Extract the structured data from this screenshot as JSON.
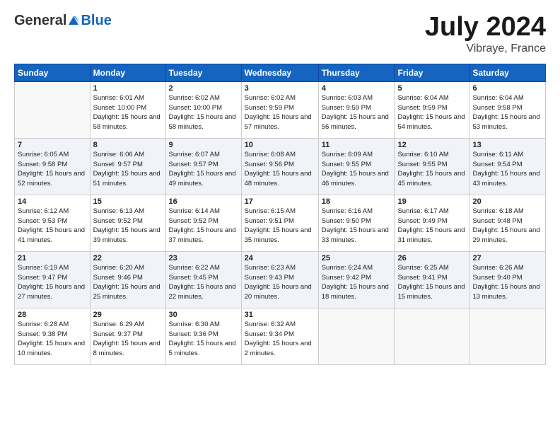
{
  "header": {
    "logo_general": "General",
    "logo_blue": "Blue",
    "month_title": "July 2024",
    "location": "Vibraye, France"
  },
  "weekdays": [
    "Sunday",
    "Monday",
    "Tuesday",
    "Wednesday",
    "Thursday",
    "Friday",
    "Saturday"
  ],
  "weeks": [
    [
      {
        "day": "",
        "empty": true
      },
      {
        "day": "1",
        "sunrise": "6:01 AM",
        "sunset": "10:00 PM",
        "daylight": "15 hours and 58 minutes."
      },
      {
        "day": "2",
        "sunrise": "6:02 AM",
        "sunset": "10:00 PM",
        "daylight": "15 hours and 58 minutes."
      },
      {
        "day": "3",
        "sunrise": "6:02 AM",
        "sunset": "9:59 PM",
        "daylight": "15 hours and 57 minutes."
      },
      {
        "day": "4",
        "sunrise": "6:03 AM",
        "sunset": "9:59 PM",
        "daylight": "15 hours and 56 minutes."
      },
      {
        "day": "5",
        "sunrise": "6:04 AM",
        "sunset": "9:59 PM",
        "daylight": "15 hours and 54 minutes."
      },
      {
        "day": "6",
        "sunrise": "6:04 AM",
        "sunset": "9:58 PM",
        "daylight": "15 hours and 53 minutes."
      }
    ],
    [
      {
        "day": "7",
        "sunrise": "6:05 AM",
        "sunset": "9:58 PM",
        "daylight": "15 hours and 52 minutes."
      },
      {
        "day": "8",
        "sunrise": "6:06 AM",
        "sunset": "9:57 PM",
        "daylight": "15 hours and 51 minutes."
      },
      {
        "day": "9",
        "sunrise": "6:07 AM",
        "sunset": "9:57 PM",
        "daylight": "15 hours and 49 minutes."
      },
      {
        "day": "10",
        "sunrise": "6:08 AM",
        "sunset": "9:56 PM",
        "daylight": "15 hours and 48 minutes."
      },
      {
        "day": "11",
        "sunrise": "6:09 AM",
        "sunset": "9:55 PM",
        "daylight": "15 hours and 46 minutes."
      },
      {
        "day": "12",
        "sunrise": "6:10 AM",
        "sunset": "9:55 PM",
        "daylight": "15 hours and 45 minutes."
      },
      {
        "day": "13",
        "sunrise": "6:11 AM",
        "sunset": "9:54 PM",
        "daylight": "15 hours and 43 minutes."
      }
    ],
    [
      {
        "day": "14",
        "sunrise": "6:12 AM",
        "sunset": "9:53 PM",
        "daylight": "15 hours and 41 minutes."
      },
      {
        "day": "15",
        "sunrise": "6:13 AM",
        "sunset": "9:52 PM",
        "daylight": "15 hours and 39 minutes."
      },
      {
        "day": "16",
        "sunrise": "6:14 AM",
        "sunset": "9:52 PM",
        "daylight": "15 hours and 37 minutes."
      },
      {
        "day": "17",
        "sunrise": "6:15 AM",
        "sunset": "9:51 PM",
        "daylight": "15 hours and 35 minutes."
      },
      {
        "day": "18",
        "sunrise": "6:16 AM",
        "sunset": "9:50 PM",
        "daylight": "15 hours and 33 minutes."
      },
      {
        "day": "19",
        "sunrise": "6:17 AM",
        "sunset": "9:49 PM",
        "daylight": "15 hours and 31 minutes."
      },
      {
        "day": "20",
        "sunrise": "6:18 AM",
        "sunset": "9:48 PM",
        "daylight": "15 hours and 29 minutes."
      }
    ],
    [
      {
        "day": "21",
        "sunrise": "6:19 AM",
        "sunset": "9:47 PM",
        "daylight": "15 hours and 27 minutes."
      },
      {
        "day": "22",
        "sunrise": "6:20 AM",
        "sunset": "9:46 PM",
        "daylight": "15 hours and 25 minutes."
      },
      {
        "day": "23",
        "sunrise": "6:22 AM",
        "sunset": "9:45 PM",
        "daylight": "15 hours and 22 minutes."
      },
      {
        "day": "24",
        "sunrise": "6:23 AM",
        "sunset": "9:43 PM",
        "daylight": "15 hours and 20 minutes."
      },
      {
        "day": "25",
        "sunrise": "6:24 AM",
        "sunset": "9:42 PM",
        "daylight": "15 hours and 18 minutes."
      },
      {
        "day": "26",
        "sunrise": "6:25 AM",
        "sunset": "9:41 PM",
        "daylight": "15 hours and 15 minutes."
      },
      {
        "day": "27",
        "sunrise": "6:26 AM",
        "sunset": "9:40 PM",
        "daylight": "15 hours and 13 minutes."
      }
    ],
    [
      {
        "day": "28",
        "sunrise": "6:28 AM",
        "sunset": "9:38 PM",
        "daylight": "15 hours and 10 minutes."
      },
      {
        "day": "29",
        "sunrise": "6:29 AM",
        "sunset": "9:37 PM",
        "daylight": "15 hours and 8 minutes."
      },
      {
        "day": "30",
        "sunrise": "6:30 AM",
        "sunset": "9:36 PM",
        "daylight": "15 hours and 5 minutes."
      },
      {
        "day": "31",
        "sunrise": "6:32 AM",
        "sunset": "9:34 PM",
        "daylight": "15 hours and 2 minutes."
      },
      {
        "day": "",
        "empty": true
      },
      {
        "day": "",
        "empty": true
      },
      {
        "day": "",
        "empty": true
      }
    ]
  ]
}
